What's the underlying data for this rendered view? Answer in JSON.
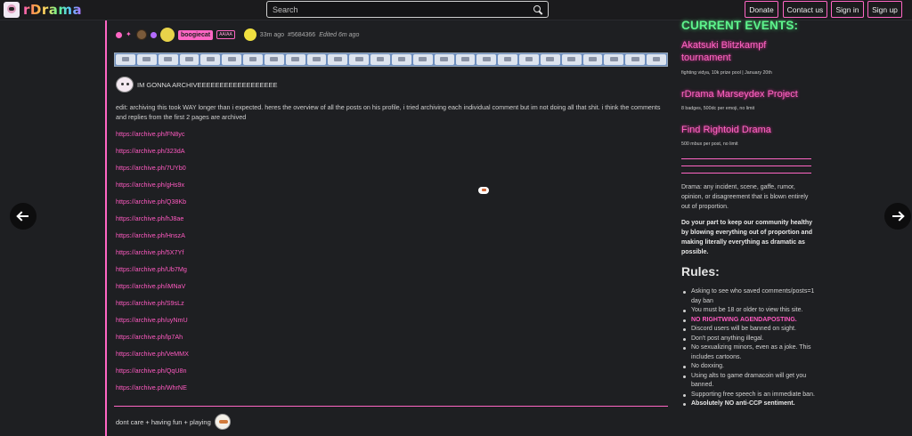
{
  "header": {
    "app_name": "rDrama",
    "search_placeholder": "Search",
    "donate": "Donate",
    "contact": "Contact us",
    "sign_in": "Sign in",
    "sign_up": "Sign up"
  },
  "post": {
    "username": "boogiecat",
    "flair": "AA/AA",
    "time": "33m ago",
    "id": "#5684366",
    "edited": "Edited 6m ago",
    "greeting": "IM GONNA ARCHIVEEEEEEEEEEEEEEEEEE",
    "edit_text": "edit: archiving this took WAY longer than i expected. heres the overview of all the posts on his profile, i tried archiving each individual comment but im not doing all that shit. i think the comments and replies from the first 2 pages are archived",
    "links": [
      "https://archive.ph/FN8yc",
      "https://archive.ph/323dA",
      "https://archive.ph/7UYb0",
      "https://archive.ph/gHs9x",
      "https://archive.ph/Q38Kb",
      "https://archive.ph/hJ8ae",
      "https://archive.ph/HnszA",
      "https://archive.ph/5X7Yf",
      "https://archive.ph/Ub7Mg",
      "https://archive.ph/iMNaV",
      "https://archive.ph/S9sLz",
      "https://archive.ph/uyNmU",
      "https://archive.ph/lp7Ah",
      "https://archive.ph/VeMMX",
      "https://archive.ph/QqU8n",
      "https://archive.ph/WhrNE"
    ],
    "footer_text": "dont care + having fun + playing"
  },
  "sidebar": {
    "events_title": "CURRENT EVENTS:",
    "events": [
      {
        "name": "Akatsuki Blitzkampf tournament",
        "desc": "fighting vidya, 10k prize pool | January 20th"
      },
      {
        "name": "rDrama Marseydex Project",
        "desc": "8 badges, 500dc per emoji, no limit"
      },
      {
        "name": "Find Rightoid Drama",
        "desc": "500 mbux per post, no limit"
      }
    ],
    "about": "Drama: any incident, scene, gaffe, rumor, opinion, or disagreement that is blown entirely out of proportion.",
    "about_bold": "Do your part to keep our community healthy by blowing everything out of proportion and making literally everything as dramatic as possible.",
    "rules_title": "Rules:",
    "rules": [
      "Asking to see who saved comments/posts=1 day ban",
      "You must be 18 or older to view this site.",
      "NO RIGHTWING AGENDAPOSTING.",
      "Discord users will be banned on sight.",
      "Don't post anything illegal.",
      "No sexualizing minors, even as a joke. This includes cartoons.",
      "No doxxing.",
      "Using alts to game dramacoin will get you banned.",
      "Supporting free speech is an immediate ban.",
      "Absolutely NO anti-CCP sentiment."
    ]
  },
  "colors": {
    "accent": "#ff66c4",
    "events_green": "#5ef38c",
    "background": "#1e1f22"
  }
}
